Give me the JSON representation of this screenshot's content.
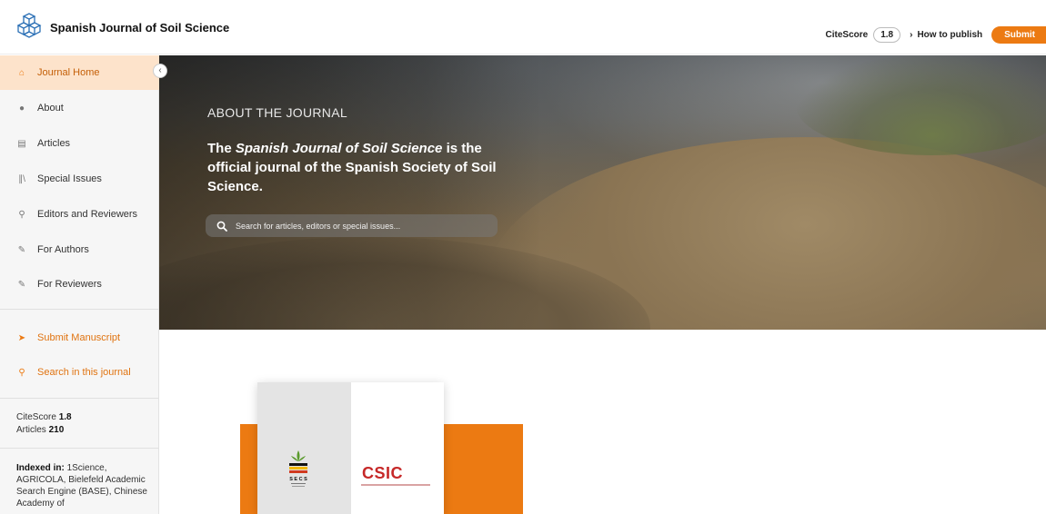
{
  "header": {
    "journal_title": "Spanish Journal of Soil Science",
    "citescore_label": "CiteScore",
    "citescore_value": "1.8",
    "how_to_publish": "How to publish",
    "submit_label": "Submit"
  },
  "sidebar": {
    "items": [
      {
        "label": "Journal Home",
        "icon": "home-icon"
      },
      {
        "label": "About",
        "icon": "info-icon"
      },
      {
        "label": "Articles",
        "icon": "document-icon"
      },
      {
        "label": "Special Issues",
        "icon": "books-icon"
      },
      {
        "label": "Editors and Reviewers",
        "icon": "user-icon"
      },
      {
        "label": "For Authors",
        "icon": "pen-icon"
      },
      {
        "label": "For Reviewers",
        "icon": "pen-icon"
      }
    ],
    "actions": [
      {
        "label": "Submit Manuscript",
        "icon": "send-icon"
      },
      {
        "label": "Search in this journal",
        "icon": "search-icon"
      }
    ],
    "stats": {
      "citescore_label": "CiteScore",
      "citescore_value": "1.8",
      "articles_label": "Articles",
      "articles_value": "210"
    },
    "indexed_label": "Indexed in:",
    "indexed_text": "1Science, AGRICOLA, Bielefeld Academic Search Engine (BASE), Chinese Academy of"
  },
  "hero": {
    "kicker": "ABOUT THE JOURNAL",
    "text_pre": "The ",
    "text_em": "Spanish Journal of Soil Science",
    "text_post": " is the official journal of the Spanish Society of Soil Science.",
    "search_placeholder": "Search for articles, editors or special issues..."
  },
  "logos": {
    "secs": "SECS",
    "csic": "CSIC"
  },
  "colors": {
    "accent": "#ec7a12",
    "active_bg": "#fde3cb",
    "csic_red": "#c62828"
  }
}
